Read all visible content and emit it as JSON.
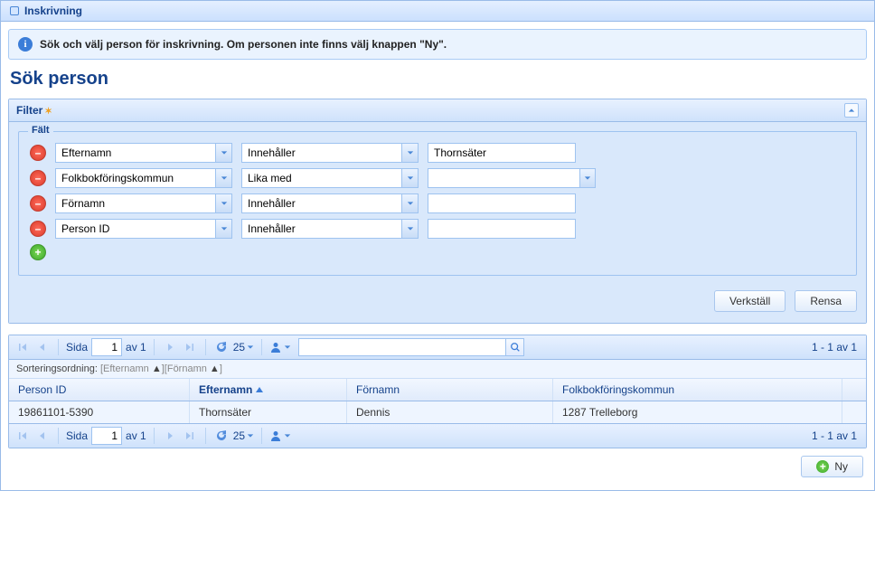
{
  "titlebar": {
    "label": "Inskrivning"
  },
  "infobox": {
    "text": "Sök och välj person för inskrivning. Om personen inte finns välj knappen \"Ny\"."
  },
  "heading": "Sök person",
  "filter_panel": {
    "title": "Filter",
    "fieldset_legend": "Fält",
    "rows": [
      {
        "field": "Efternamn",
        "op": "Innehåller",
        "value": "Thornsäter",
        "value_kind": "text"
      },
      {
        "field": "Folkbokföringskommun",
        "op": "Lika med",
        "value": "",
        "value_kind": "combo"
      },
      {
        "field": "Förnamn",
        "op": "Innehåller",
        "value": "",
        "value_kind": "text"
      },
      {
        "field": "Person ID",
        "op": "Innehåller",
        "value": "",
        "value_kind": "text"
      }
    ],
    "buttons": {
      "apply": "Verkställ",
      "clear": "Rensa"
    }
  },
  "toolbar": {
    "page_label_prefix": "Sida",
    "page_current": "1",
    "page_label_suffix": "av 1",
    "page_size": "25",
    "range_text": "1 - 1 av 1"
  },
  "sortbar": {
    "prefix": "Sorteringsordning: ",
    "segments": [
      "[",
      "Efternamn ",
      "▲",
      "][",
      "Förnamn ",
      "▲",
      "]"
    ]
  },
  "grid": {
    "columns": [
      {
        "key": "person_id",
        "label": "Person ID",
        "sorted": false
      },
      {
        "key": "efternamn",
        "label": "Efternamn",
        "sorted": true
      },
      {
        "key": "fornamn",
        "label": "Förnamn",
        "sorted": false
      },
      {
        "key": "kommun",
        "label": "Folkbokföringskommun",
        "sorted": false
      }
    ],
    "rows": [
      {
        "person_id": "19861101-5390",
        "efternamn": "Thornsäter",
        "fornamn": "Dennis",
        "kommun": "1287 Trelleborg"
      }
    ]
  },
  "footer": {
    "new_label": "Ny"
  }
}
